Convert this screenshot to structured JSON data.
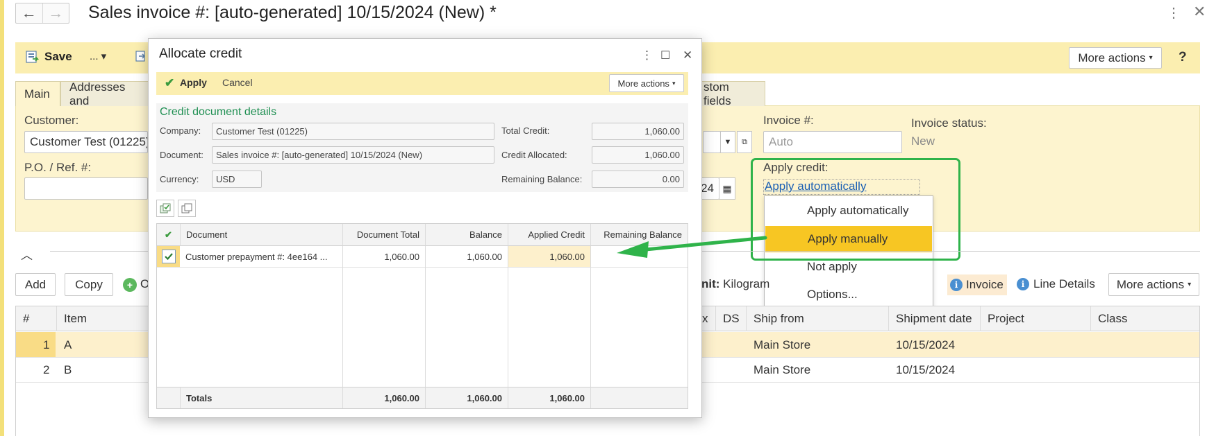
{
  "window": {
    "title": "Sales invoice #: [auto-generated] 10/15/2024 (New) *",
    "back_glyph": "←",
    "forward_glyph": "→",
    "menu_glyph": "⋮",
    "close_glyph": "✕"
  },
  "toolbar": {
    "save_label": "Save",
    "more_label": "... ▾",
    "more_actions_label": "More actions",
    "help_label": "?"
  },
  "tabs": [
    {
      "label": "Main",
      "active": true
    },
    {
      "label": "Addresses and",
      "active": false
    },
    {
      "label": "stom fields",
      "active": false
    }
  ],
  "form": {
    "customer_label": "Customer:",
    "customer_value": "Customer Test (01225)",
    "po_label": "P.O. / Ref. #:",
    "po_value": "",
    "invoice_num_label": "Invoice #:",
    "invoice_num_placeholder": "Auto",
    "invoice_status_label": "Invoice status:",
    "invoice_status_value": "New",
    "apply_credit_label": "Apply credit:",
    "apply_credit_value": "Apply automatically",
    "date_fragment": "24"
  },
  "apply_credit_dropdown": {
    "options": [
      "Apply automatically",
      "Apply manually",
      "Not apply",
      "Options..."
    ],
    "selected": "Apply manually"
  },
  "grid_toolbar": {
    "add_label": "Add",
    "copy_label": "Copy",
    "o_label": "O",
    "unit_label": "nit:",
    "unit_value": "Kilogram",
    "invoice_label": "Invoice",
    "line_details_label": "Line Details",
    "more_actions_label": "More actions"
  },
  "main_grid": {
    "columns": [
      "#",
      "Item",
      "x",
      "DS",
      "Ship from",
      "Shipment date",
      "Project",
      "Class"
    ],
    "rows": [
      {
        "num": "1",
        "item": "A",
        "ship_from": "Main Store",
        "shipment_date": "10/15/2024"
      },
      {
        "num": "2",
        "item": "B",
        "ship_from": "Main Store",
        "shipment_date": "10/15/2024"
      }
    ]
  },
  "dialog": {
    "title": "Allocate credit",
    "apply_label": "Apply",
    "cancel_label": "Cancel",
    "more_actions_label": "More actions",
    "details_title": "Credit document details",
    "company_label": "Company:",
    "company_value": "Customer Test (01225)",
    "document_label": "Document:",
    "document_value": "Sales invoice #: [auto-generated] 10/15/2024 (New)",
    "currency_label": "Currency:",
    "currency_value": "USD",
    "total_credit_label": "Total Credit:",
    "total_credit_value": "1,060.00",
    "credit_allocated_label": "Credit Allocated:",
    "credit_allocated_value": "1,060.00",
    "remaining_balance_label": "Remaining Balance:",
    "remaining_balance_value": "0.00",
    "grid": {
      "columns": [
        "Document",
        "Document Total",
        "Balance",
        "Applied Credit",
        "Remaining Balance"
      ],
      "rows": [
        {
          "checked": true,
          "document": "Customer prepayment #: 4ee164 ...",
          "document_total": "1,060.00",
          "balance": "1,060.00",
          "applied_credit": "1,060.00",
          "remaining_balance": ""
        }
      ],
      "totals": {
        "label": "Totals",
        "document_total": "1,060.00",
        "balance": "1,060.00",
        "applied_credit": "1,060.00"
      }
    }
  },
  "colors": {
    "toolbar_bg": "#fbeeb0",
    "selected_option": "#f7c623",
    "highlight_green": "#2fb34a",
    "link_blue": "#1a5fb4"
  }
}
